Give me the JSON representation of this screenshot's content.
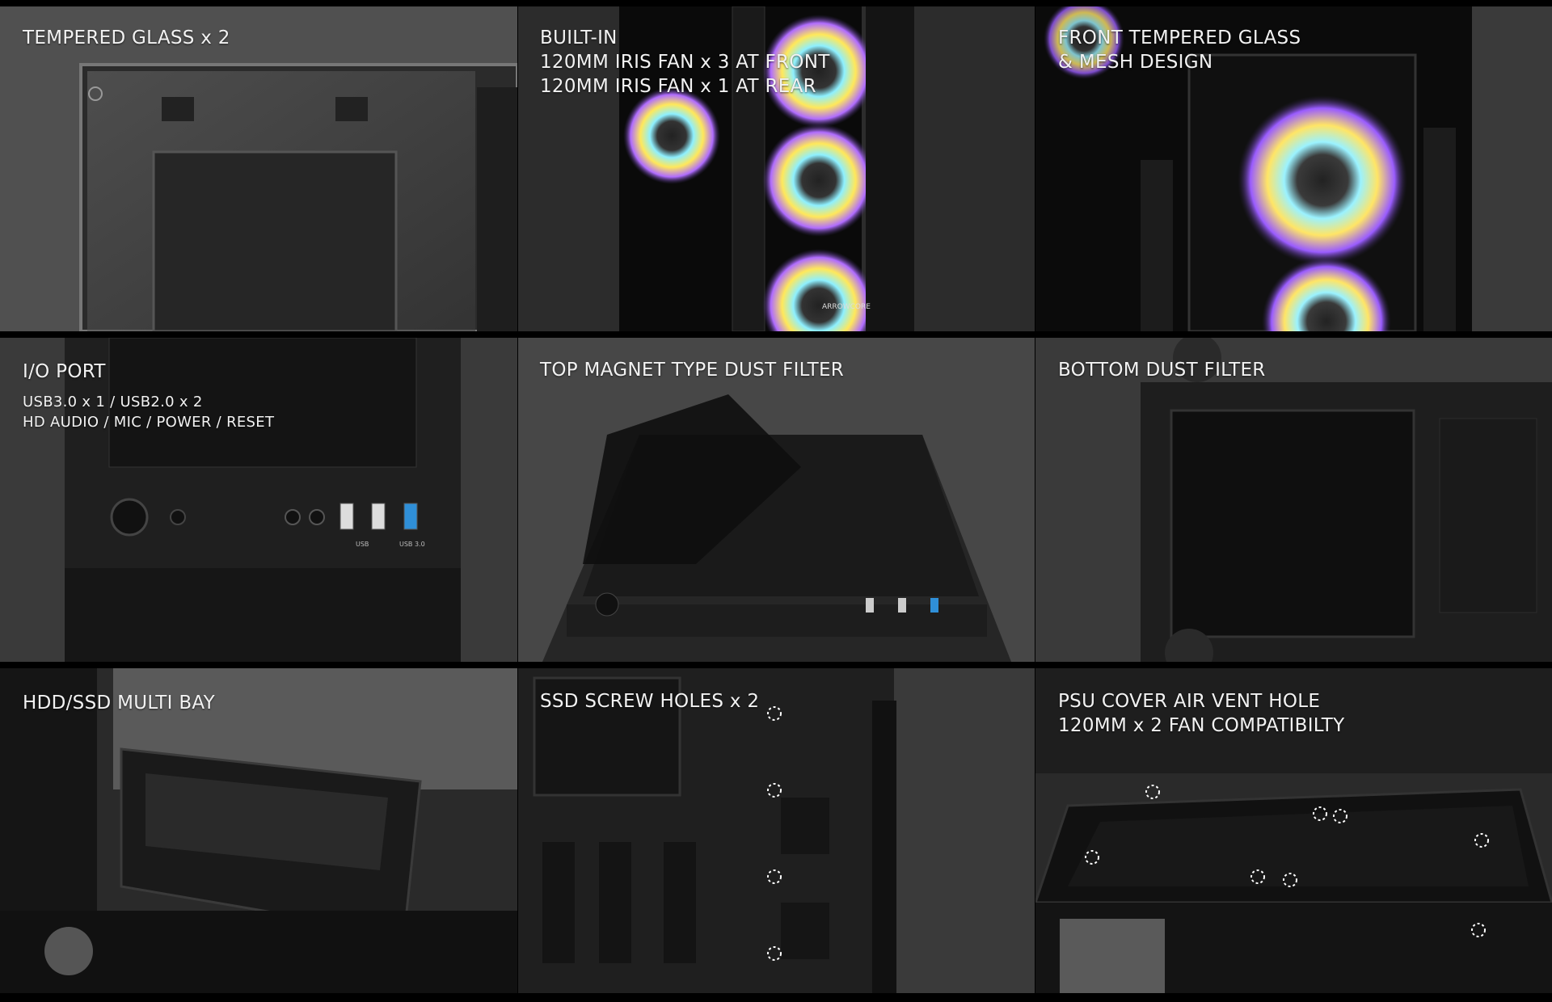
{
  "panels": [
    {
      "lines": [
        "TEMPERED GLASS x 2"
      ],
      "sub": []
    },
    {
      "lines": [
        "BUILT-IN",
        "120MM IRIS FAN x 3 AT FRONT",
        "120MM IRIS FAN x 1 AT REAR"
      ],
      "sub": []
    },
    {
      "lines": [
        "FRONT TEMPERED GLASS",
        "& MESH DESIGN"
      ],
      "sub": []
    },
    {
      "lines": [
        "I/O PORT"
      ],
      "sub": [
        "USB3.0 x 1 / USB2.0 x 2",
        "HD AUDIO / MIC / POWER / RESET"
      ]
    },
    {
      "lines": [
        "TOP MAGNET TYPE DUST FILTER"
      ],
      "sub": []
    },
    {
      "lines": [
        "BOTTOM DUST FILTER"
      ],
      "sub": []
    },
    {
      "lines": [
        "HDD/SSD MULTI BAY"
      ],
      "sub": []
    },
    {
      "lines": [
        "SSD SCREW HOLES x 2"
      ],
      "sub": []
    },
    {
      "lines": [
        "PSU COVER AIR VENT HOLE",
        "120MM x 2 FAN COMPATIBILTY"
      ],
      "sub": []
    }
  ],
  "port_labels": {
    "usb": "USB",
    "usb3": "USB 3.0"
  },
  "fan_logo": "ARROWCORE",
  "colors": {
    "panel_bg": "#3c3c3c",
    "case_dark": "#1c1c1c",
    "usb3_blue": "#2f8fd8",
    "caption": "#f2f2f2"
  }
}
